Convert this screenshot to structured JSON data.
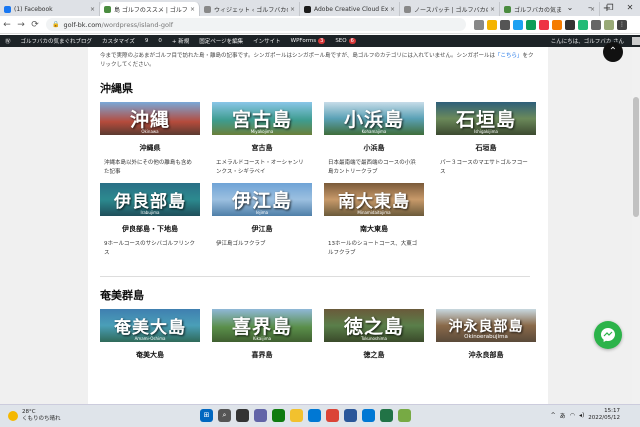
{
  "browser": {
    "tabs": [
      {
        "title": "(1) Facebook",
        "color": "#1877f2",
        "active": false
      },
      {
        "title": "島 ゴルフのススメ | ゴルフバカの気ま",
        "color": "#4a8c3f",
        "active": true
      },
      {
        "title": "ウィジェット ‹ ゴルフバカの気まぐれ",
        "color": "#888888",
        "active": false
      },
      {
        "title": "Adobe Creative Cloud Expr",
        "color": "#1b1b1b",
        "active": false
      },
      {
        "title": "ノースパッチ | ゴルフバカの気ま",
        "color": "#888888",
        "active": false
      },
      {
        "title": "ゴルフバカの気ま",
        "color": "#4a8c3f",
        "active": false
      }
    ],
    "new_tab": "+",
    "win_controls": [
      "⌄",
      "–",
      "❐",
      "✕"
    ],
    "url_host": "golf-bk.com",
    "url_path": "/wordpress/island-golf"
  },
  "admin_bar": {
    "items": [
      "ゴルフバカの気まぐれブログ",
      "カスタマイズ",
      "9",
      "0",
      "+ 新規",
      "固定ページを編集"
    ],
    "insight": "インサイト",
    "wpforms": "WPForms",
    "wpforms_badge": "3",
    "seo": "SEO",
    "seo_badge": "6",
    "greeting": "こんにちは、ゴルフバカ さん"
  },
  "page": {
    "intro": "今まで実際のぶあまがゴルフ目で訪れた島・離島の記事です。シンガポールはシンガポール島ですが、島ゴルフのカテゴリには入れていません。シンガポールは",
    "intro_link": "「こちら」",
    "intro_tail": "をクリックしてください。",
    "sections": [
      {
        "title": "沖縄県",
        "cards": [
          {
            "thumb": "沖縄",
            "sub": "Okinawa",
            "bg": "linear-gradient(180deg,#7aa8d8 0%,#b54b3c 60%,#5a3a30 100%)",
            "name": "沖縄県",
            "desc": "沖縄本島以外にその他の離島も含めた記事"
          },
          {
            "thumb": "宮古島",
            "sub": "Miyakojima",
            "bg": "linear-gradient(180deg,#8ac6e8 0%,#3e9c8f 55%,#6b7f3a 100%)",
            "name": "宮古島",
            "desc": "エメラルドコースト・オーシャンリンクス・シギラベイ"
          },
          {
            "thumb": "小浜島",
            "sub": "Kohamajima",
            "bg": "linear-gradient(180deg,#c7dce8 0%,#5aa1b6 50%,#3f6d3a 100%)",
            "name": "小浜島",
            "desc": "日本最南端で最西端のコースの小浜島カントリークラブ"
          },
          {
            "thumb": "石垣島",
            "sub": "Ishigakijima",
            "bg": "linear-gradient(180deg,#2e5f7a 0%,#6b8a5a 50%,#3c4a30 100%)",
            "name": "石垣島",
            "desc": "パー３コースのマエサトゴルフコース"
          },
          {
            "thumb": "伊良部島",
            "sub": "Irabujima",
            "bg": "linear-gradient(180deg,#2a6f86 0%,#2c8a8f 50%,#1f4e5a 100%)",
            "name": "伊良部島・下地島",
            "desc": "9ホールコースのサシバゴルフリンクス"
          },
          {
            "thumb": "伊江島",
            "sub": "Iejima",
            "bg": "linear-gradient(180deg,#6fa3d6 0%,#9cc0e0 50%,#4f7fa8 100%)",
            "name": "伊江島",
            "desc": "伊江島ゴルフクラブ"
          },
          {
            "thumb": "南大東島",
            "sub": "Minamidaitojima",
            "bg": "linear-gradient(180deg,#7a5a3a 0%,#c89a6a 50%,#6b5a3a 100%)",
            "name": "南大東島",
            "desc": "13ホールのショートコース、大東ゴルフクラブ"
          }
        ]
      },
      {
        "title": "奄美群島",
        "cards": [
          {
            "thumb": "奄美大島",
            "sub": "Amami-Oshima",
            "bg": "linear-gradient(180deg,#3f7fb0 0%,#4a9fb8 50%,#2f6a5a 100%)",
            "name": "奄美大島",
            "desc": ""
          },
          {
            "thumb": "喜界島",
            "sub": "Kikaijima",
            "bg": "linear-gradient(180deg,#8fb8d8 0%,#5a8f4a 55%,#3f5f30 100%)",
            "name": "喜界島",
            "desc": ""
          },
          {
            "thumb": "徳之島",
            "sub": "Tokunoshima",
            "bg": "linear-gradient(180deg,#6a5a3a 0%,#5a7f4a 50%,#3a4a2a 100%)",
            "name": "徳之島",
            "desc": ""
          },
          {
            "thumb": "沖永良部島",
            "sub": "Okinoerabujima",
            "bg": "linear-gradient(180deg,#c8d8e0 0%,#8a6a4a 50%,#5a4a3a 100%)",
            "name": "沖永良部島",
            "desc": ""
          }
        ]
      }
    ],
    "scroll_top": "⌃"
  },
  "taskbar": {
    "temp": "28°C",
    "weather": "くもりのち晴れ",
    "ime": "あ",
    "time": "15:17",
    "date": "2022/05/12"
  }
}
